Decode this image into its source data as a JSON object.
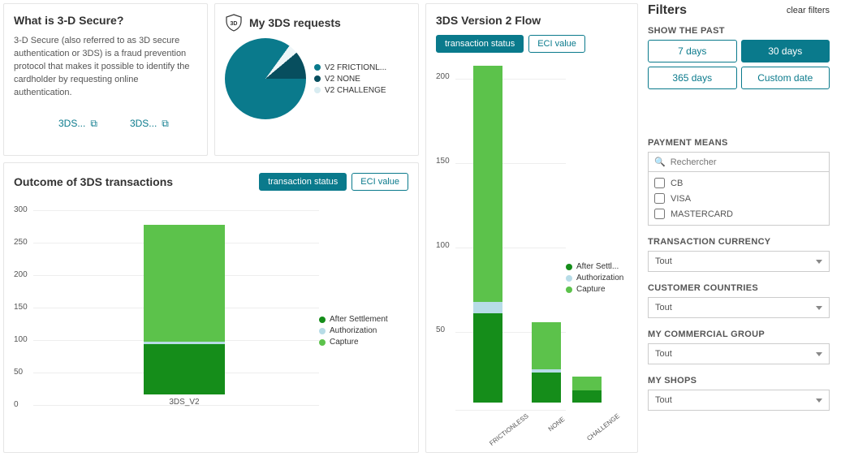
{
  "what_is": {
    "title": "What is 3-D Secure?",
    "body": "3-D Secure (also referred to as 3D secure authentication or 3DS) is a fraud prevention protocol that makes it possible to identify the cardholder by requesting online authentication.",
    "link1": "3DS...",
    "link2": "3DS..."
  },
  "requests": {
    "title": "My 3DS requests",
    "legend": {
      "a": "V2 FRICTIONL...",
      "b": "V2 NONE",
      "c": "V2 CHALLENGE"
    }
  },
  "outcome": {
    "title": "Outcome of 3DS transactions",
    "toggle_a": "transaction status",
    "toggle_b": "ECI value",
    "legend": {
      "after": "After Settlement",
      "auth": "Authorization",
      "cap": "Capture"
    },
    "xcat": "3DS_V2",
    "ylabels": {
      "0": "0",
      "50": "50",
      "100": "100",
      "150": "150",
      "200": "200",
      "250": "250",
      "300": "300"
    }
  },
  "flow": {
    "title": "3DS Version 2 Flow",
    "toggle_a": "transaction status",
    "toggle_b": "ECI value",
    "legend": {
      "after": "After Settl...",
      "auth": "Authorization",
      "cap": "Capture"
    },
    "cats": {
      "a": "FRICTIONLESS",
      "b": "NONE",
      "c": "CHALLENGE"
    },
    "ylabels": {
      "50": "50",
      "100": "100",
      "150": "150",
      "200": "200"
    }
  },
  "filters": {
    "title": "Filters",
    "clear": "clear filters",
    "show_past": "SHOW THE PAST",
    "d7": "7 days",
    "d30": "30 days",
    "d365": "365 days",
    "dcustom": "Custom date",
    "payment_means": "PAYMENT MEANS",
    "search_placeholder": "Rechercher",
    "opt_cb": "CB",
    "opt_visa": "VISA",
    "opt_mc": "MASTERCARD",
    "currency": "TRANSACTION CURRENCY",
    "countries": "CUSTOMER COUNTRIES",
    "group": "MY COMMERCIAL GROUP",
    "shops": "MY SHOPS",
    "tout": "Tout"
  },
  "colors": {
    "teal": "#0a7a8c",
    "darkgreen": "#158d1a",
    "green": "#5cc24b",
    "lightblue": "#b7dce7"
  },
  "chart_data": [
    {
      "type": "pie",
      "title": "My 3DS requests",
      "series": [
        {
          "name": "V2 FRICTIONL...",
          "value": 78
        },
        {
          "name": "V2 NONE",
          "value": 12
        },
        {
          "name": "V2 CHALLENGE",
          "value": 10
        }
      ]
    },
    {
      "type": "bar",
      "title": "Outcome of 3DS transactions",
      "categories": [
        "3DS_V2"
      ],
      "series": [
        {
          "name": "After Settlement",
          "values": [
            78
          ]
        },
        {
          "name": "Authorization",
          "values": [
            3
          ]
        },
        {
          "name": "Capture",
          "values": [
            180
          ]
        }
      ],
      "ylim": [
        0,
        300
      ],
      "stacked": true
    },
    {
      "type": "bar",
      "title": "3DS Version 2 Flow",
      "categories": [
        "FRICTIONLESS",
        "NONE",
        "CHALLENGE"
      ],
      "series": [
        {
          "name": "After Settl...",
          "values": [
            53,
            18,
            7
          ]
        },
        {
          "name": "Authorization",
          "values": [
            7,
            2,
            0
          ]
        },
        {
          "name": "Capture",
          "values": [
            140,
            28,
            8
          ]
        }
      ],
      "ylim": [
        0,
        200
      ],
      "stacked": true
    }
  ]
}
